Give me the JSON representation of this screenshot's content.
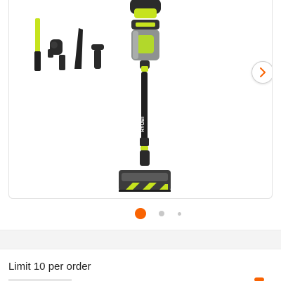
{
  "product": {
    "image_icon": "vacuum-product-image",
    "brand_mark": "RYOBI",
    "next_icon": "chevron-right-icon"
  },
  "carousel": {
    "total_dots": 3,
    "active_index": 0,
    "active_color": "#f96302",
    "inactive_color": "#c8c8c8"
  },
  "order": {
    "limit_text": "Limit 10 per order"
  },
  "colors": {
    "accent": "#f96302",
    "product_green": "#c6e31e",
    "product_dark": "#222222"
  }
}
